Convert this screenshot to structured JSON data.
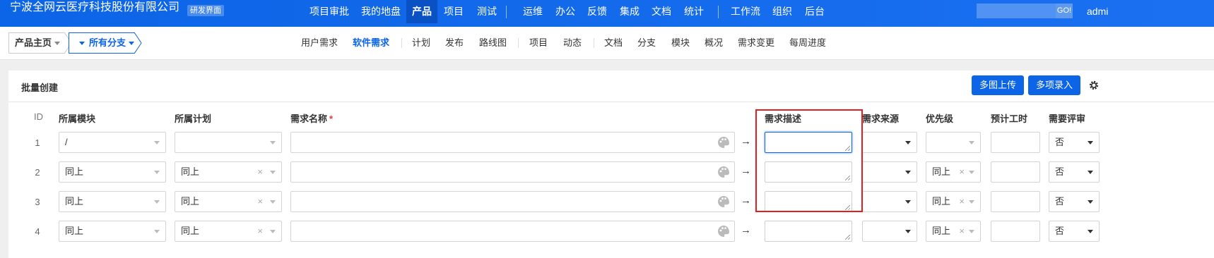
{
  "header": {
    "company": "宁波全网云医疗科技股份有限公司",
    "env_badge": "研发界面",
    "nav": [
      {
        "label": "项目审批"
      },
      {
        "label": "我的地盘"
      },
      {
        "label": "产品",
        "active": true
      },
      {
        "label": "项目"
      },
      {
        "label": "测试"
      },
      {
        "label": "运维"
      },
      {
        "label": "办公"
      },
      {
        "label": "反馈"
      },
      {
        "label": "集成"
      },
      {
        "label": "文档"
      },
      {
        "label": "统计"
      },
      {
        "label": "工作流"
      },
      {
        "label": "组织"
      },
      {
        "label": "后台"
      }
    ],
    "search_placeholder": "",
    "search_button": "GO!",
    "user": "admi"
  },
  "breadcrumb": {
    "product_home": "产品主页",
    "branch": "所有分支"
  },
  "subnav": [
    {
      "label": "用户需求"
    },
    {
      "label": "软件需求",
      "active": true
    },
    {
      "label": "计划"
    },
    {
      "label": "发布"
    },
    {
      "label": "路线图"
    },
    {
      "label": "项目"
    },
    {
      "label": "动态"
    },
    {
      "label": "文档"
    },
    {
      "label": "分支"
    },
    {
      "label": "模块"
    },
    {
      "label": "概况"
    },
    {
      "label": "需求变更"
    },
    {
      "label": "每周进度"
    }
  ],
  "panel": {
    "title": "批量创建",
    "btn_multi_image": "多图上传",
    "btn_multi_entry": "多项录入",
    "columns": {
      "id": "ID",
      "module": "所属模块",
      "plan": "所属计划",
      "name": "需求名称",
      "name_required": "*",
      "desc": "需求描述",
      "source": "需求来源",
      "priority": "优先级",
      "estimate": "预计工时",
      "review": "需要评审"
    },
    "rows": [
      {
        "id": "1",
        "module": "/",
        "plan": "",
        "name": "",
        "source": "",
        "priority": "",
        "estimate": "",
        "review": "否"
      },
      {
        "id": "2",
        "module": "同上",
        "plan": "同上",
        "name": "",
        "source": "",
        "priority": "同上",
        "estimate": "",
        "review": "否"
      },
      {
        "id": "3",
        "module": "同上",
        "plan": "同上",
        "name": "",
        "source": "",
        "priority": "同上",
        "estimate": "",
        "review": "否"
      },
      {
        "id": "4",
        "module": "同上",
        "plan": "同上",
        "name": "",
        "source": "",
        "priority": "同上",
        "estimate": "",
        "review": "否"
      }
    ],
    "clear_glyph": "×",
    "arrow_glyph": "→"
  },
  "colors": {
    "brand_blue": "#0c64e6",
    "highlight_red": "#e02020"
  }
}
